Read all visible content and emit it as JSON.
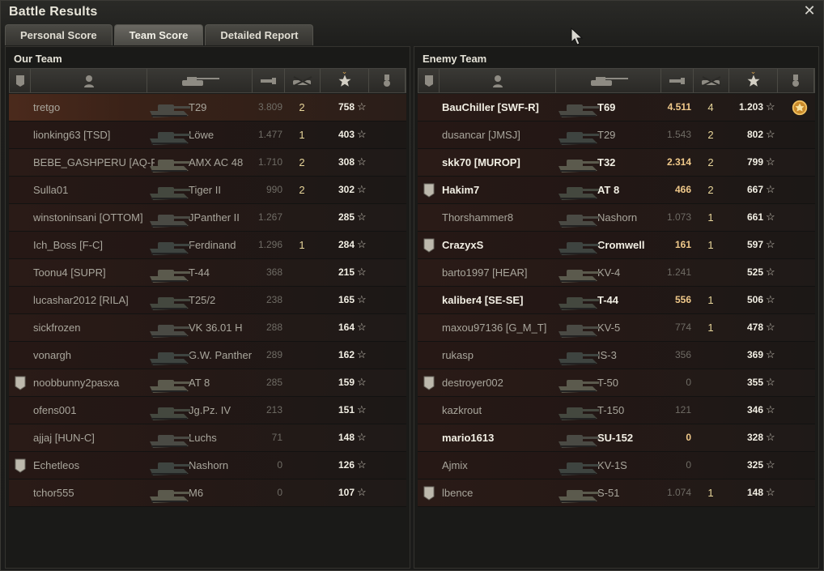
{
  "window": {
    "title": "Battle Results",
    "close_icon": "close-icon"
  },
  "tabs": [
    {
      "label": "Personal Score",
      "active": false
    },
    {
      "label": "Team Score",
      "active": true
    },
    {
      "label": "Detailed Report",
      "active": false
    }
  ],
  "header_icons": [
    "squad-icon",
    "player-icon",
    "tank-icon",
    "damage-icon",
    "kills-icon",
    "experience-star-icon",
    "medal-icon"
  ],
  "our_team": {
    "title": "Our Team",
    "rows": [
      {
        "name": "tretgo",
        "tank": "T29",
        "damage": "3.809",
        "kills": "2",
        "xp": "758",
        "highlight": true
      },
      {
        "name": "lionking63 [TSD]",
        "tank": "Löwe",
        "damage": "1.477",
        "kills": "1",
        "xp": "403"
      },
      {
        "name": "BEBE_GASHPERU [AQ-R..",
        "tank": "AMX AC 48",
        "damage": "1.710",
        "kills": "2",
        "xp": "308"
      },
      {
        "name": "Sulla01",
        "tank": "Tiger II",
        "damage": "990",
        "kills": "2",
        "xp": "302"
      },
      {
        "name": "winstoninsani [OTTOM]",
        "tank": "JPanther II",
        "damage": "1.267",
        "kills": "",
        "xp": "285"
      },
      {
        "name": "Ich_Boss [F-C]",
        "tank": "Ferdinand",
        "damage": "1.296",
        "kills": "1",
        "xp": "284"
      },
      {
        "name": "Toonu4 [SUPR]",
        "tank": "T-44",
        "damage": "368",
        "kills": "",
        "xp": "215"
      },
      {
        "name": "lucashar2012 [RILA]",
        "tank": "T25/2",
        "damage": "238",
        "kills": "",
        "xp": "165"
      },
      {
        "name": "sickfrozen",
        "tank": "VK 36.01 H",
        "damage": "288",
        "kills": "",
        "xp": "164"
      },
      {
        "name": "vonargh",
        "tank": "G.W. Panther",
        "damage": "289",
        "kills": "",
        "xp": "162"
      },
      {
        "name": "noobbunny2pasxa",
        "tank": "AT 8",
        "damage": "285",
        "kills": "",
        "xp": "159",
        "squad": true
      },
      {
        "name": "ofens001",
        "tank": "Jg.Pz. IV",
        "damage": "213",
        "kills": "",
        "xp": "151"
      },
      {
        "name": "ajjaj [HUN-C]",
        "tank": "Luchs",
        "damage": "71",
        "kills": "",
        "xp": "148"
      },
      {
        "name": "Echetleos",
        "tank": "Nashorn",
        "damage": "0",
        "kills": "",
        "xp": "126",
        "squad": true
      },
      {
        "name": "tchor555",
        "tank": "M6",
        "damage": "0",
        "kills": "",
        "xp": "107"
      }
    ]
  },
  "enemy_team": {
    "title": "Enemy Team",
    "rows": [
      {
        "name": "BauChiller [SWF-R]",
        "tank": "T69",
        "damage": "4.511",
        "kills": "4",
        "xp": "1.203",
        "bold": true,
        "medal": true
      },
      {
        "name": "dusancar [JMSJ]",
        "tank": "T29",
        "damage": "1.543",
        "kills": "2",
        "xp": "802"
      },
      {
        "name": "skk70 [MUROP]",
        "tank": "T32",
        "damage": "2.314",
        "kills": "2",
        "xp": "799",
        "bold": true
      },
      {
        "name": "Hakim7",
        "tank": "AT 8",
        "damage": "466",
        "kills": "2",
        "xp": "667",
        "bold": true,
        "squad": true
      },
      {
        "name": "Thorshammer8",
        "tank": "Nashorn",
        "damage": "1.073",
        "kills": "1",
        "xp": "661"
      },
      {
        "name": "CrazyxS",
        "tank": "Cromwell",
        "damage": "161",
        "kills": "1",
        "xp": "597",
        "bold": true,
        "squad": true
      },
      {
        "name": "barto1997 [HEAR]",
        "tank": "KV-4",
        "damage": "1.241",
        "kills": "",
        "xp": "525"
      },
      {
        "name": "kaliber4 [SE-SE]",
        "tank": "T-44",
        "damage": "556",
        "kills": "1",
        "xp": "506",
        "bold": true
      },
      {
        "name": "maxou97136 [G_M_T]",
        "tank": "KV-5",
        "damage": "774",
        "kills": "1",
        "xp": "478"
      },
      {
        "name": "rukasp",
        "tank": "IS-3",
        "damage": "356",
        "kills": "",
        "xp": "369"
      },
      {
        "name": "destroyer002",
        "tank": "T-50",
        "damage": "0",
        "kills": "",
        "xp": "355",
        "squad": true
      },
      {
        "name": "kazkrout",
        "tank": "T-150",
        "damage": "121",
        "kills": "",
        "xp": "346"
      },
      {
        "name": "mario1613",
        "tank": "SU-152",
        "damage": "0",
        "kills": "",
        "xp": "328",
        "bold": true
      },
      {
        "name": "Ajmix",
        "tank": "KV-1S",
        "damage": "0",
        "kills": "",
        "xp": "325"
      },
      {
        "name": "lbence",
        "tank": "S-51",
        "damage": "1.074",
        "kills": "1",
        "xp": "148",
        "squad": true
      }
    ]
  },
  "colors": {
    "accent": "#d9a24a",
    "bold_damage": "#f0c98a",
    "row_highlight": "#4b2a1c"
  }
}
